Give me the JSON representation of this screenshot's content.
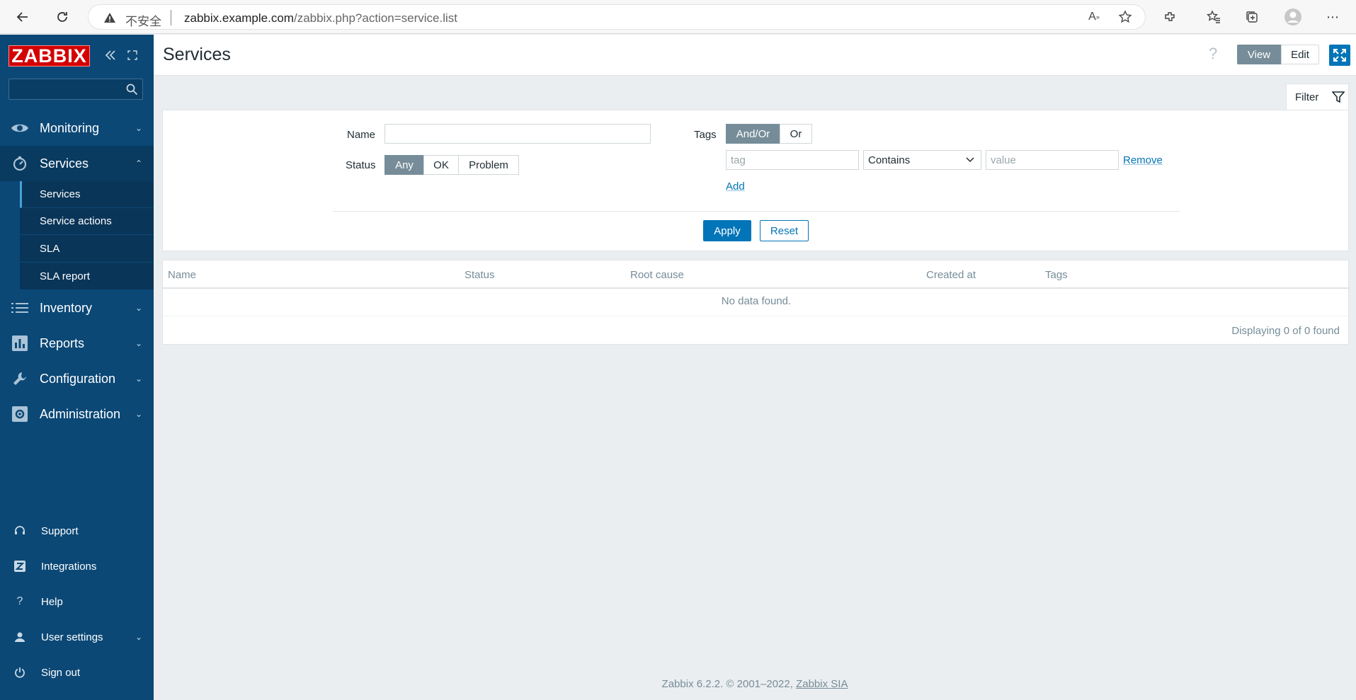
{
  "browser": {
    "insecure_label": "不安全",
    "url_host": "zabbix.example.com",
    "url_path": "/zabbix.php?action=service.list"
  },
  "sidebar": {
    "logo": "ZABBIX",
    "search": {
      "placeholder": "",
      "value": ""
    },
    "menu": [
      {
        "label": "Monitoring",
        "icon": "eye-icon"
      },
      {
        "label": "Services",
        "icon": "stopwatch-icon",
        "expanded": true
      },
      {
        "label": "Inventory",
        "icon": "list-icon"
      },
      {
        "label": "Reports",
        "icon": "bar-chart-icon"
      },
      {
        "label": "Configuration",
        "icon": "wrench-icon"
      },
      {
        "label": "Administration",
        "icon": "gear-icon"
      }
    ],
    "submenu": [
      {
        "label": "Services",
        "current": true
      },
      {
        "label": "Service actions"
      },
      {
        "label": "SLA"
      },
      {
        "label": "SLA report"
      }
    ],
    "bottom": [
      {
        "label": "Support",
        "icon": "headset-icon"
      },
      {
        "label": "Integrations",
        "icon": "z-icon"
      },
      {
        "label": "Help",
        "icon": "question-icon"
      },
      {
        "label": "User settings",
        "icon": "user-icon"
      },
      {
        "label": "Sign out",
        "icon": "power-icon"
      }
    ]
  },
  "header": {
    "title": "Services",
    "help": "?",
    "view_label": "View",
    "edit_label": "Edit"
  },
  "filter": {
    "tab_label": "Filter",
    "name_label": "Name",
    "name_value": "",
    "status_label": "Status",
    "status_options": [
      "Any",
      "OK",
      "Problem"
    ],
    "status_selected": "Any",
    "tags_label": "Tags",
    "tags_options": [
      "And/Or",
      "Or"
    ],
    "tags_selected": "And/Or",
    "tag_placeholder": "tag",
    "operator_value": "Contains",
    "value_placeholder": "value",
    "remove_label": "Remove",
    "add_label": "Add",
    "apply_label": "Apply",
    "reset_label": "Reset"
  },
  "table": {
    "columns": [
      "Name",
      "Status",
      "Root cause",
      "Created at",
      "Tags"
    ],
    "empty_text": "No data found.",
    "paging": "Displaying 0 of 0 found"
  },
  "footer": {
    "text": "Zabbix 6.2.2. © 2001–2022,",
    "link": "Zabbix SIA"
  },
  "colors": {
    "sidebar": "#0b4876",
    "brand_red": "#d40000",
    "accent": "#0275b8",
    "selected_segment": "#768d99"
  }
}
